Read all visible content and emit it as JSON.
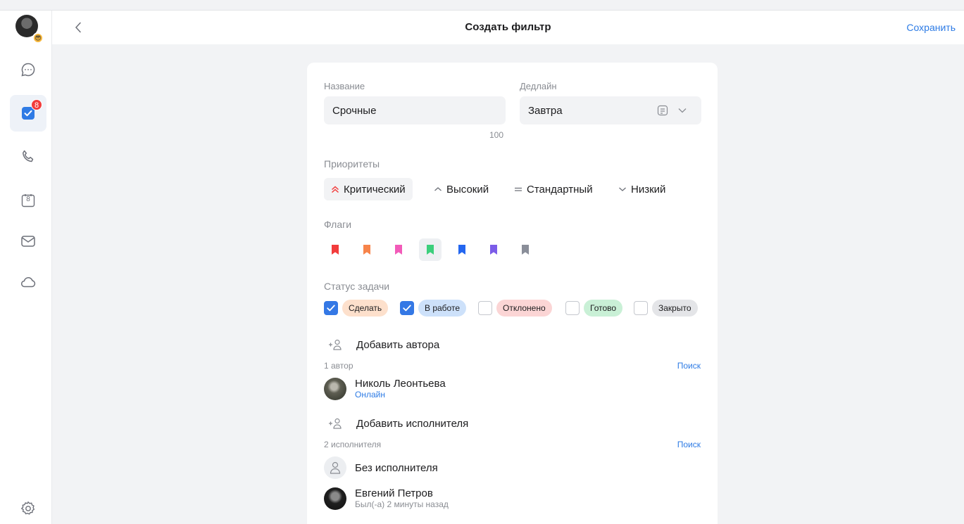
{
  "header": {
    "title": "Создать фильтр",
    "save_label": "Сохранить"
  },
  "sidebar": {
    "tasks_badge": "8",
    "calendar_day": "8",
    "items": [
      {
        "icon": "chat-icon"
      },
      {
        "icon": "tasks-icon"
      },
      {
        "icon": "phone-icon"
      },
      {
        "icon": "calendar-icon"
      },
      {
        "icon": "mail-icon"
      },
      {
        "icon": "cloud-icon"
      },
      {
        "icon": "settings-icon"
      }
    ]
  },
  "form": {
    "name": {
      "label": "Название",
      "value": "Срочные",
      "counter": "100"
    },
    "deadline": {
      "label": "Дедлайн",
      "value": "Завтра"
    },
    "priorities": {
      "label": "Приоритеты",
      "options": [
        {
          "label": "Критический",
          "selected": true
        },
        {
          "label": "Высокий",
          "selected": false
        },
        {
          "label": "Стандартный",
          "selected": false
        },
        {
          "label": "Низкий",
          "selected": false
        }
      ]
    },
    "flags": {
      "label": "Флаги",
      "colors": [
        "#f23c3c",
        "#f7844a",
        "#f25bb9",
        "#3ccf7c",
        "#2366f0",
        "#7b5ce8",
        "#8a8e99"
      ],
      "selected_index": 3
    },
    "status": {
      "label": "Статус задачи",
      "options": [
        {
          "label": "Сделать",
          "checked": true,
          "color": "#fde0cc"
        },
        {
          "label": "В работе",
          "checked": true,
          "color": "#cde1fa"
        },
        {
          "label": "Отклонено",
          "checked": false,
          "color": "#fbd5d5"
        },
        {
          "label": "Готово",
          "checked": false,
          "color": "#c9f0d6"
        },
        {
          "label": "Закрыто",
          "checked": false,
          "color": "#e4e5e8"
        }
      ]
    },
    "authors": {
      "add_label": "Добавить автора",
      "count": "1 автор",
      "search": "Поиск",
      "people": [
        {
          "name": "Николь Леонтьева",
          "status": "Онлайн"
        }
      ]
    },
    "assignees": {
      "add_label": "Добавить исполнителя",
      "count": "2 исполнителя",
      "search": "Поиск",
      "people": [
        {
          "name": "Без исполнителя"
        },
        {
          "name": "Евгений Петров",
          "status": "Был(-а) 2 минуты назад"
        }
      ]
    }
  }
}
